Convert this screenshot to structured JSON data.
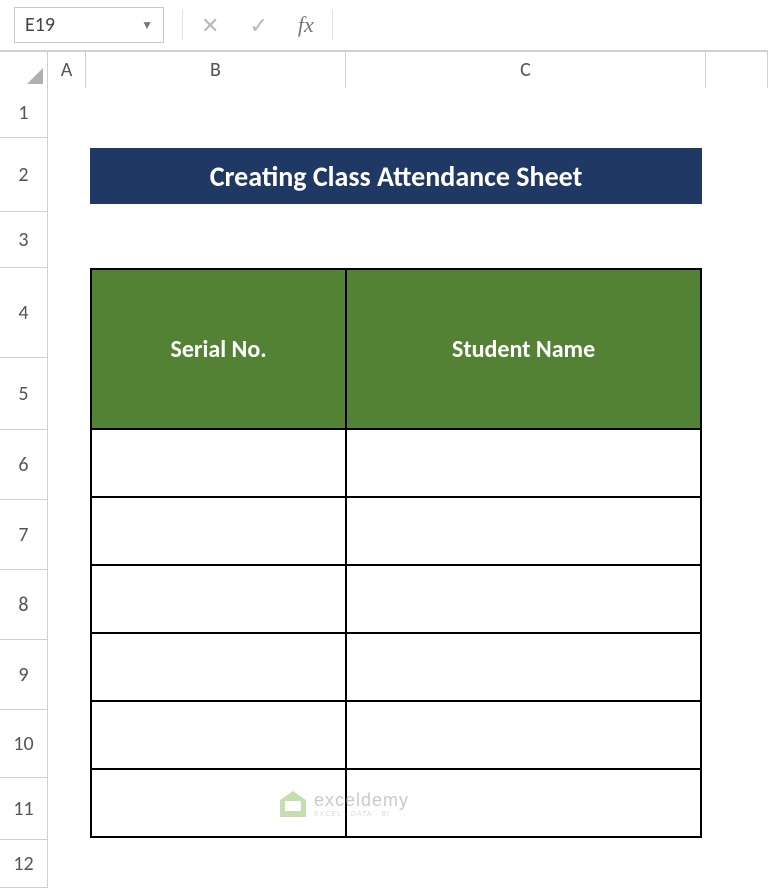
{
  "formula_bar": {
    "cell_ref": "E19",
    "formula_value": "",
    "fx_label": "fx"
  },
  "columns": {
    "a": "A",
    "b": "B",
    "c": "C"
  },
  "rows": [
    "1",
    "2",
    "3",
    "4",
    "5",
    "6",
    "7",
    "8",
    "9",
    "10",
    "11",
    "12"
  ],
  "sheet": {
    "title": "Creating Class Attendance Sheet",
    "table": {
      "headers": {
        "serial": "Serial No.",
        "name": "Student Name"
      },
      "body_rows": [
        {
          "serial": "",
          "name": ""
        },
        {
          "serial": "",
          "name": ""
        },
        {
          "serial": "",
          "name": ""
        },
        {
          "serial": "",
          "name": ""
        },
        {
          "serial": "",
          "name": ""
        },
        {
          "serial": "",
          "name": ""
        }
      ]
    }
  },
  "watermark": {
    "main": "exceldemy",
    "sub": "EXCEL · DATA · BI"
  }
}
